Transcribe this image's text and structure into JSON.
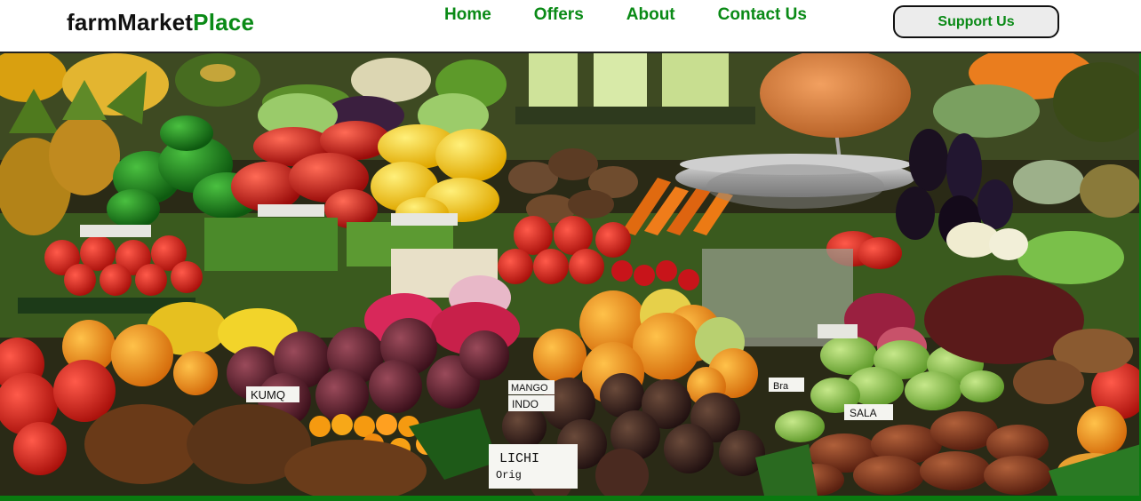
{
  "brand": {
    "logo_primary": "farmMarket",
    "logo_accent": "Place",
    "accent_color": "#0a8a16"
  },
  "nav": {
    "items": [
      {
        "label": "Home"
      },
      {
        "label": "Offers"
      },
      {
        "label": "About"
      },
      {
        "label": "Contact Us"
      }
    ],
    "support_button": "Support Us"
  },
  "hero": {
    "signs": [
      "KUMQ",
      "LICHI",
      "Orig",
      "INDO",
      "SALA",
      "MANGO",
      "Bra"
    ]
  }
}
